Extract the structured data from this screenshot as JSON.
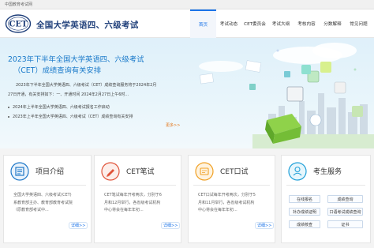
{
  "topbar": {
    "text": "中国教育考试网"
  },
  "header": {
    "logo_text": "CET",
    "site_title": "全国大学英语四、六级考试"
  },
  "nav": {
    "items": [
      {
        "label": "首页"
      },
      {
        "label": "考试动态"
      },
      {
        "label": "CET委员会"
      },
      {
        "label": "考试大纲"
      },
      {
        "label": "考核内容"
      },
      {
        "label": "分数解释"
      },
      {
        "label": "常见问题"
      }
    ]
  },
  "banner": {
    "title_line1": "2023年下半年全国大学英语四、六级考试",
    "title_line2": "（CET）成绩查询有关安排",
    "notices": [
      "2023年下半年全国大学英语四、六级考试（CET）成绩查询服务将于2024年2月",
      "27日开通，有关安排如下：一、开通时间 2024年2月27日上午6时...",
      "2024年上半年全国大学英语四、六级考试报名工作启动",
      "2023年上半年全国大学英语四、六级考试（CET）成绩查询有关安排"
    ],
    "more_label": "更多>>"
  },
  "cards": [
    {
      "title": "项目介绍",
      "lines": [
        "全国大学英语四、六级考试(CET)",
        "系教育部主办、教育部教育考试院",
        "（原教育部考试中..."
      ],
      "more_label": "详细>>",
      "accent": "#1f78c8",
      "icon": "book-icon"
    },
    {
      "title": "CET笔试",
      "lines": [
        "CET笔试每年开考两次，分别于6",
        "月和12月举行，各省级考试机构",
        "中心将会在每年年初..."
      ],
      "more_label": "详细>>",
      "accent": "#e0543a",
      "icon": "pencil-icon"
    },
    {
      "title": "CET口试",
      "lines": [
        "CET口试每年开考两次，分别于5",
        "月和11月举行，各省级考试机构",
        "中心将会在每年年初..."
      ],
      "more_label": "详细>>",
      "accent": "#f0a024",
      "icon": "microphone-icon"
    },
    {
      "title": "考生服务",
      "accent": "#1f9fd8",
      "icon": "user-icon",
      "buttons": [
        "在线报名",
        "成绩查询",
        "补办成绩证明",
        "口语考试成绩查询",
        "成绩核查",
        "证书"
      ]
    }
  ]
}
